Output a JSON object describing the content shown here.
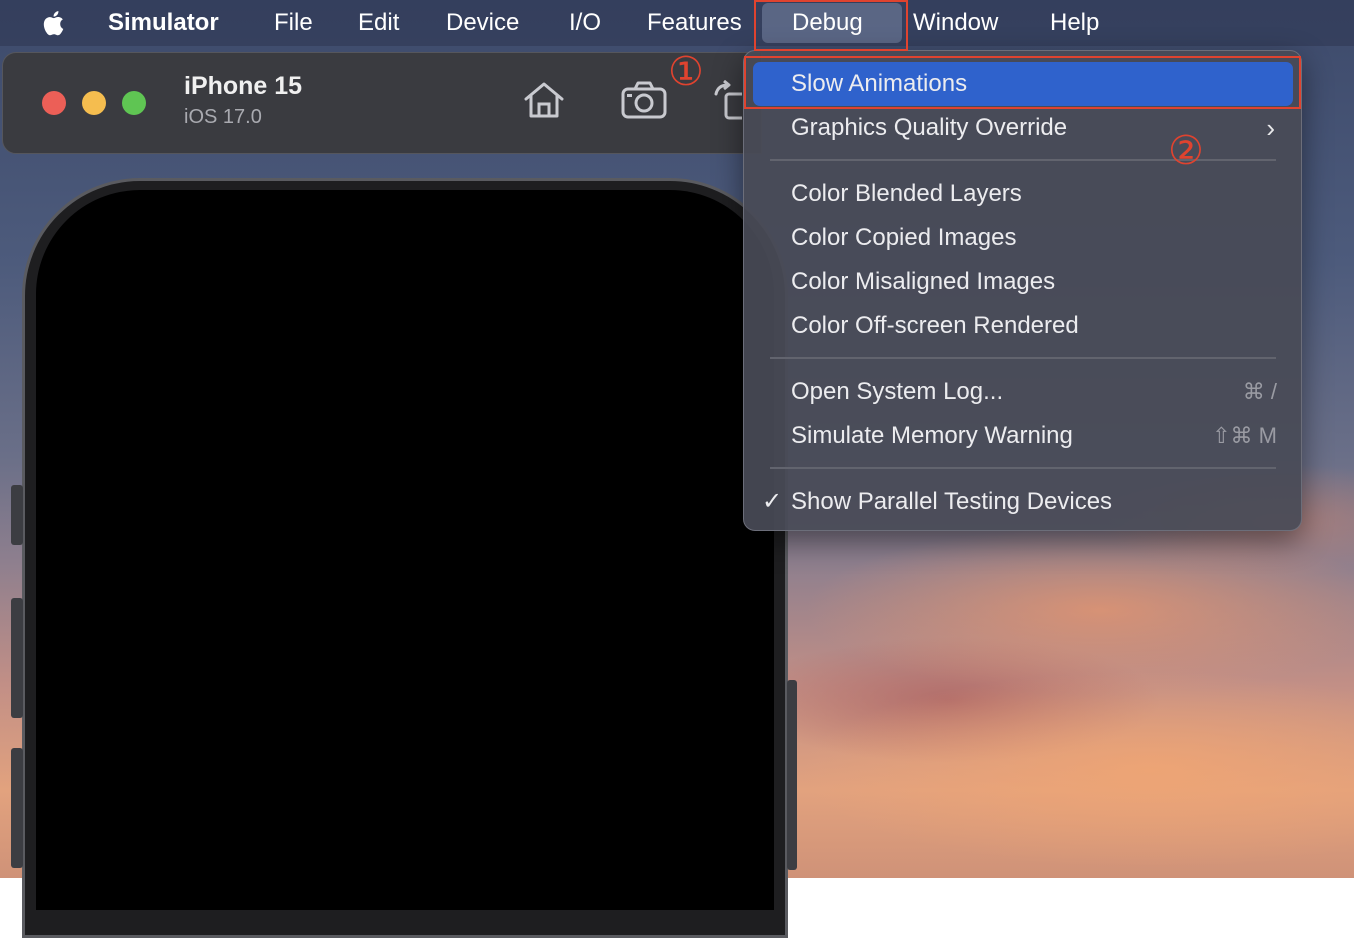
{
  "menubar": {
    "app_name": "Simulator",
    "items": [
      "File",
      "Edit",
      "Device",
      "I/O",
      "Features",
      "Debug",
      "Window",
      "Help"
    ],
    "active_item": "Debug"
  },
  "simulator_window": {
    "device_name": "iPhone 15",
    "os_version": "iOS 17.0",
    "toolbar_icons": [
      "home-icon",
      "screenshot-camera-icon",
      "rotate-icon"
    ]
  },
  "debug_menu": {
    "items": [
      {
        "label": "Slow Animations",
        "highlighted": true
      },
      {
        "label": "Graphics Quality Override",
        "submenu": true
      },
      {
        "label": "Color Blended Layers"
      },
      {
        "label": "Color Copied Images"
      },
      {
        "label": "Color Misaligned Images"
      },
      {
        "label": "Color Off-screen Rendered"
      },
      {
        "label": "Open System Log...",
        "shortcut": "⌘ /"
      },
      {
        "label": "Simulate Memory Warning",
        "shortcut": "⇧⌘ M"
      },
      {
        "label": "Show Parallel Testing Devices",
        "checked": true
      }
    ],
    "check_glyph": "✓",
    "submenu_glyph": "›"
  },
  "annotations": {
    "step1": "①",
    "step2": "②",
    "color": "#e0432f"
  },
  "colors": {
    "highlight": "#2f62cc",
    "traffic_red": "#ec5f57",
    "traffic_yellow": "#f5bd4f",
    "traffic_green": "#5fc553"
  }
}
